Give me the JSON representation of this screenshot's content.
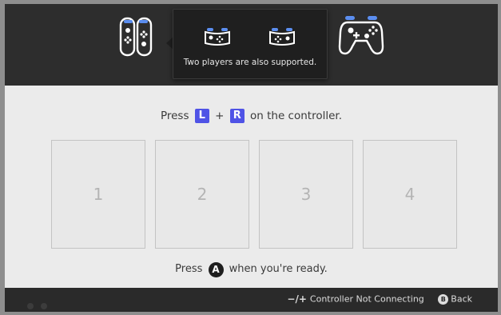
{
  "tooltip": {
    "text": "Two players are also supported."
  },
  "instruction": {
    "before": "Press",
    "key_l": "L",
    "plus": "+",
    "key_r": "R",
    "after": "on the controller."
  },
  "slots": [
    "1",
    "2",
    "3",
    "4"
  ],
  "ready": {
    "before": "Press",
    "button": "A",
    "after": "when you're ready."
  },
  "footer": {
    "minus_plus": "−/+",
    "controller_not_connecting": "Controller Not Connecting",
    "back_button": "B",
    "back_label": "Back"
  },
  "colors": {
    "key_badge": "#4f53e6",
    "joycon_accent": "#5b8ef0",
    "panel_bg": "#ebebeb",
    "dark_bg": "#2d2d2d"
  },
  "icons": [
    "joycon-pair-icon",
    "single-joycon-icon",
    "pro-controller-icon"
  ]
}
